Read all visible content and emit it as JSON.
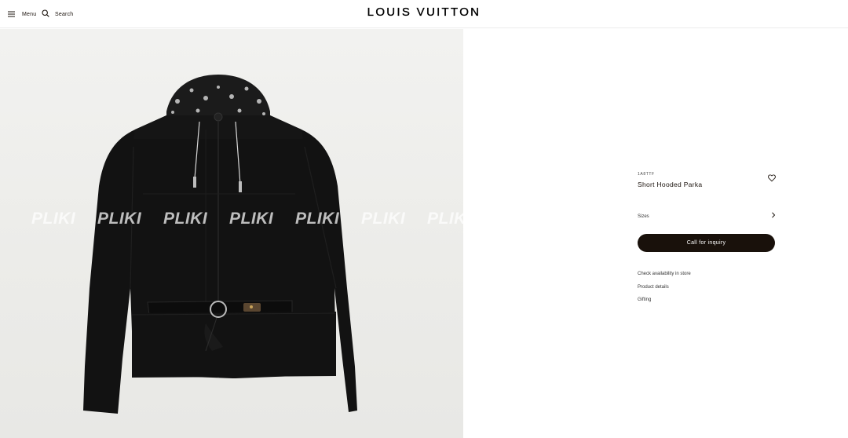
{
  "header": {
    "menu_label": "Menu",
    "search_label": "Search",
    "brand": "LOUIS VUITTON"
  },
  "hero": {
    "watermark_text": "PLIKI",
    "watermark_count": 7
  },
  "product": {
    "reference": "1A8TTF",
    "name": "Short Hooded Parka",
    "sizes_label": "Sizes",
    "cta_label": "Call for inquiry",
    "links": [
      "Check availability in store",
      "Product details",
      "Gifting"
    ]
  },
  "icons": {
    "menu": "hamburger-icon",
    "search": "search-icon",
    "wishlist": "heart-icon",
    "sizes": "chevron-right-icon"
  },
  "colors": {
    "cta_background": "#19110b",
    "text": "#19110b",
    "jacket": "#121212"
  }
}
